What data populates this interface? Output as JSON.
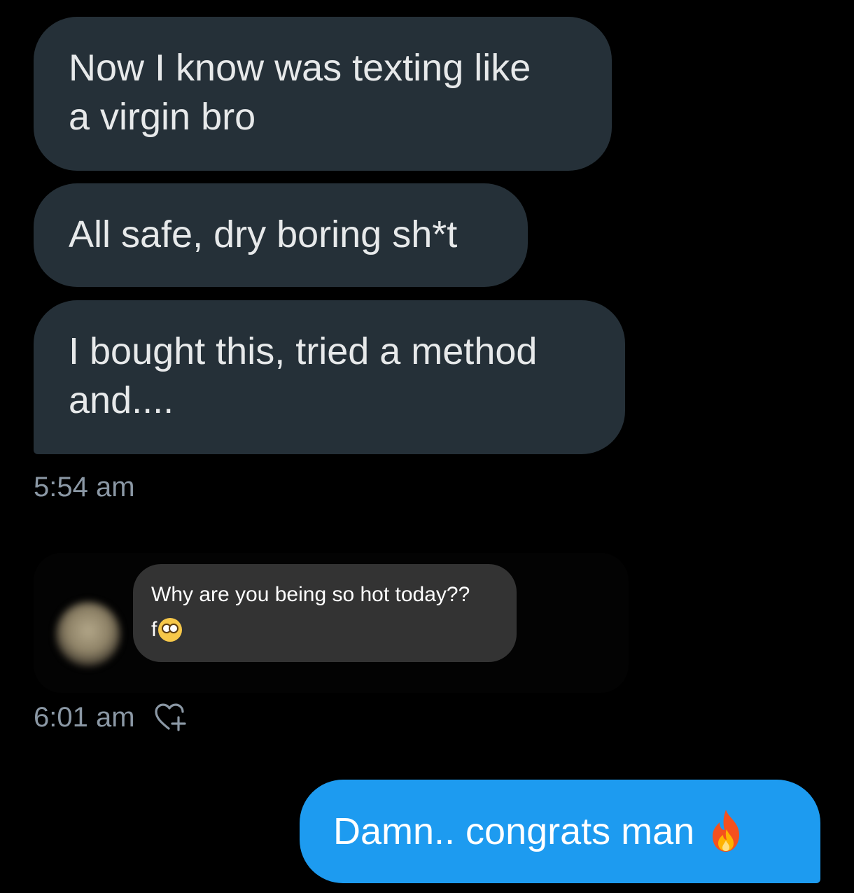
{
  "messages_in": [
    {
      "text": "Now I know was texting like\na virgin bro"
    },
    {
      "text": "All safe, dry boring sh*t"
    },
    {
      "text": "I bought this, tried a method\nand...."
    }
  ],
  "timestamp_1": "5:54 am",
  "shared_story": {
    "line1": "Why are you being so hot today??",
    "line2_prefix": "f",
    "emoji_icon": "flushed-face-icon"
  },
  "timestamp_2": "6:01 am",
  "react_icon": "heart-plus-icon",
  "message_out": {
    "text": "Damn.. congrats man",
    "emoji_icon": "fire-icon"
  },
  "colors": {
    "background": "#000000",
    "incoming_bubble": "#253038",
    "outgoing_bubble": "#1d9bf0",
    "timestamp": "#8b98a5",
    "story_bubble": "#333333"
  }
}
